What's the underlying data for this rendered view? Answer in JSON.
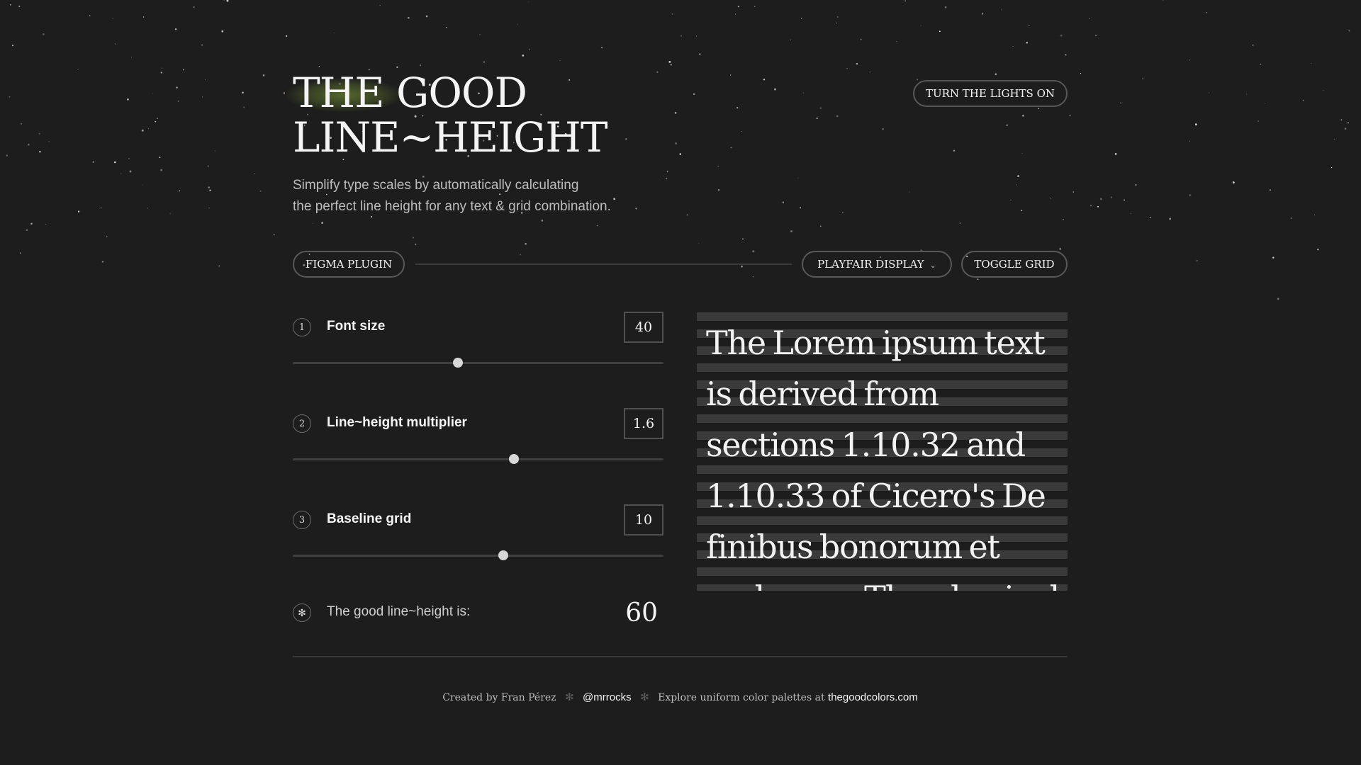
{
  "header": {
    "title_line1": "THE GOOD",
    "title_line2": "LINE~HEIGHT",
    "subtitle_line1": "Simplify type scales by automatically calculating",
    "subtitle_line2": "the perfect line height for any text & grid combination.",
    "lights_button": "TURN THE LIGHTS ON"
  },
  "toolbar": {
    "figma_button": "FIGMA PLUGIN",
    "font_select": "PLAYFAIR DISPLAY",
    "toggle_grid_button": "TOGGLE GRID"
  },
  "controls": [
    {
      "number": "1",
      "label": "Font size",
      "value": "40",
      "slider_fraction": 0.445
    },
    {
      "number": "2",
      "label": "Line~height multiplier",
      "value": "1.6",
      "slider_fraction": 0.597
    },
    {
      "number": "3",
      "label": "Baseline grid",
      "value": "10",
      "slider_fraction": 0.568
    }
  ],
  "result": {
    "icon": "✻",
    "label": "The good line~height is:",
    "value": "60"
  },
  "preview": {
    "text": "The Lorem ipsum text is derived from sections 1.10.32 and 1.10.33 of Cicero's De finibus bonorum et malorum. The physical"
  },
  "footer": {
    "created_by": "Created by Fran Pérez",
    "separator": "✻",
    "twitter_link": "@mrrocks",
    "explore_text": "Explore uniform color palettes at",
    "site_link": "thegoodcolors.com"
  },
  "icons": {
    "dropdown": "chevron-down-icon",
    "result": "asterisk-icon"
  },
  "colors": {
    "background": "#1d1d1d",
    "text": "#f4f4f4",
    "muted": "#bdbdbd",
    "border": "#585858",
    "grid_stripe": "#3a3a3a",
    "glow": "#688030"
  }
}
